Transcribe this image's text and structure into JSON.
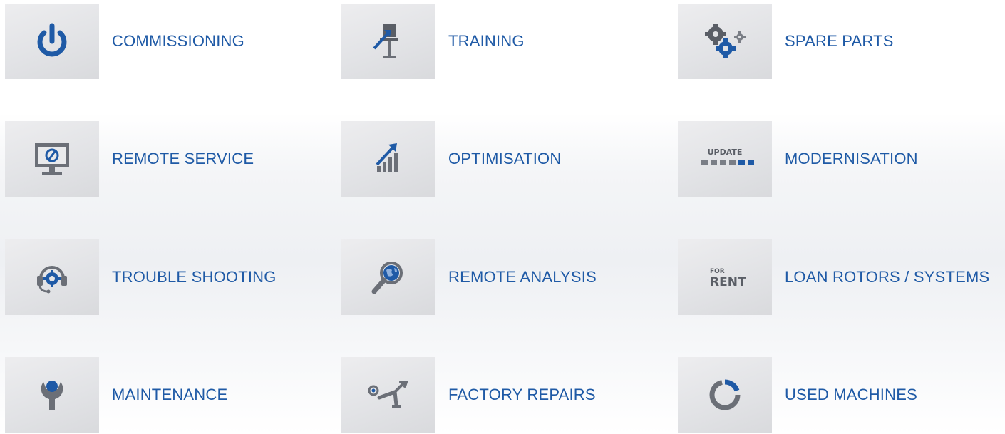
{
  "tiles": [
    {
      "label": "COMMISSIONING",
      "icon": "power-icon"
    },
    {
      "label": "TRAINING",
      "icon": "presentation-icon"
    },
    {
      "label": "SPARE PARTS",
      "icon": "gears-icon"
    },
    {
      "label": "REMOTE SERVICE",
      "icon": "monitor-icon"
    },
    {
      "label": "OPTIMISATION",
      "icon": "growth-chart-icon"
    },
    {
      "label": "MODERNISATION",
      "icon": "update-icon"
    },
    {
      "label": "TROUBLE SHOOTING",
      "icon": "headset-icon"
    },
    {
      "label": "REMOTE ANALYSIS",
      "icon": "magnifier-globe-icon"
    },
    {
      "label": "LOAN ROTORS / SYSTEMS",
      "icon": "for-rent-icon"
    },
    {
      "label": "MAINTENANCE",
      "icon": "wrench-icon"
    },
    {
      "label": "FACTORY REPAIRS",
      "icon": "robot-arm-icon"
    },
    {
      "label": "USED MACHINES",
      "icon": "recycle-ring-icon"
    }
  ],
  "icon_text": {
    "update": "UPDATE",
    "for": "FOR",
    "rent": "RENT"
  },
  "colors": {
    "accent_blue": "#1f5aa6",
    "icon_gray": "#6b6f77",
    "tile_bg": "#e4e5e8"
  }
}
